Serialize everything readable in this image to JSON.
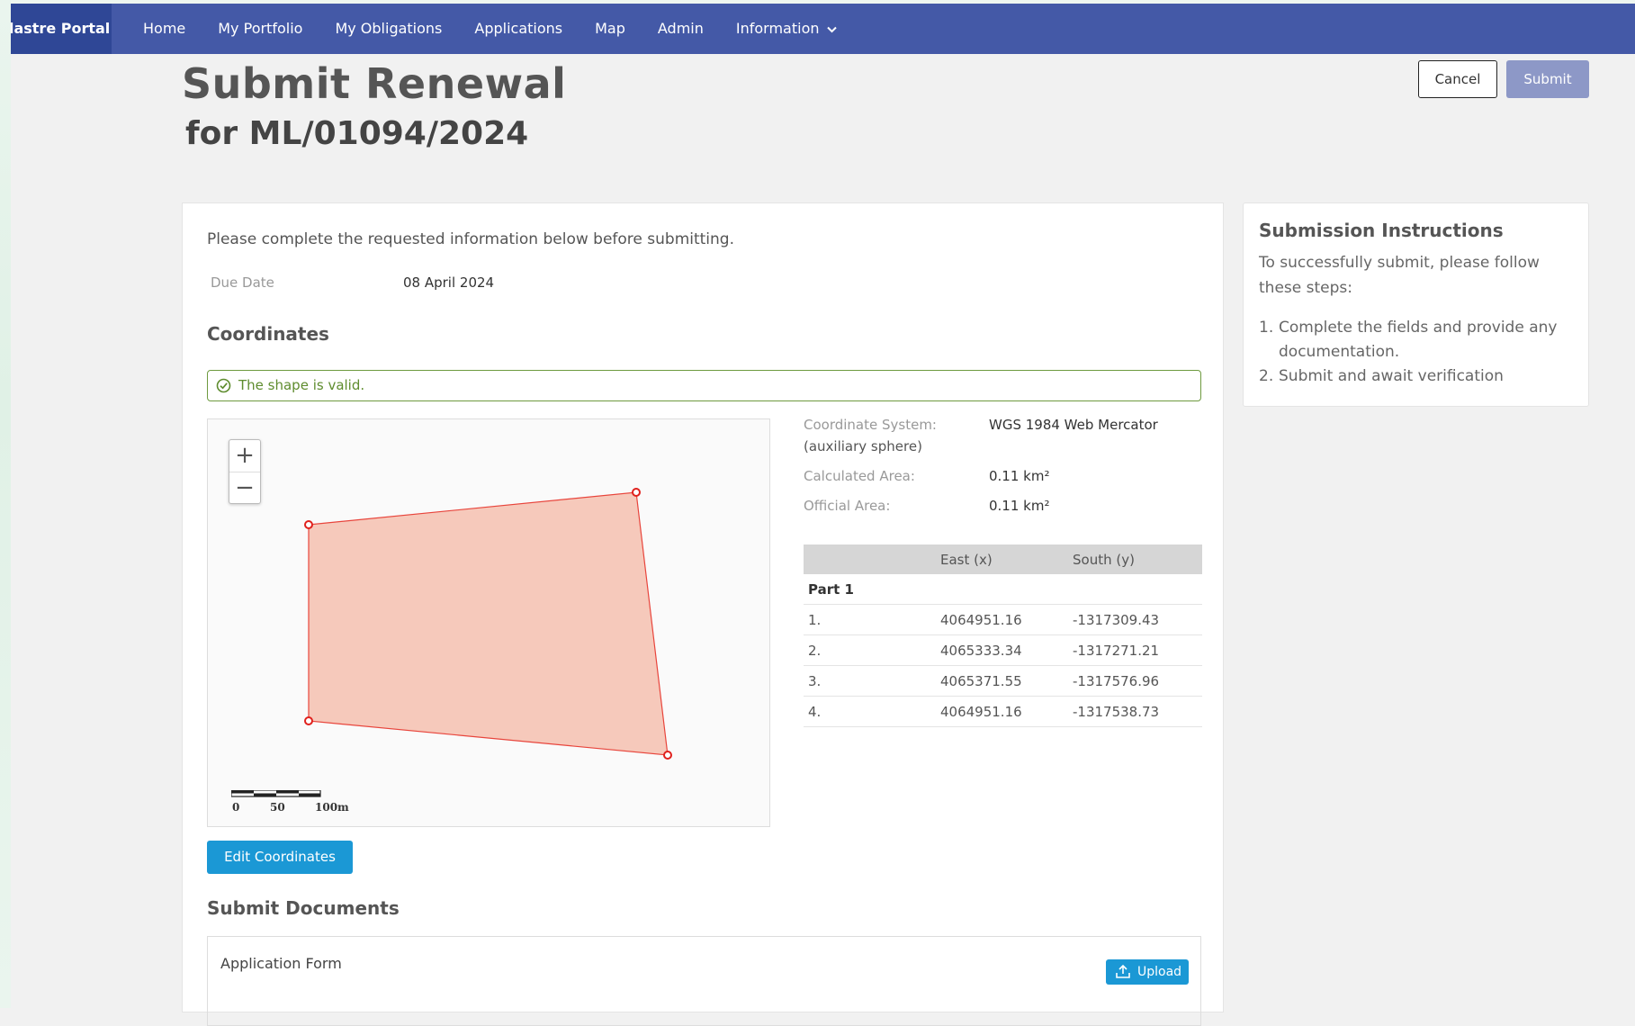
{
  "nav": {
    "brand": "dastre Portal",
    "items": [
      {
        "label": "Home"
      },
      {
        "label": "My Portfolio"
      },
      {
        "label": "My Obligations"
      },
      {
        "label": "Applications"
      },
      {
        "label": "Map"
      },
      {
        "label": "Admin"
      },
      {
        "label": "Information"
      }
    ]
  },
  "header": {
    "title": "Submit Renewal",
    "subtitle": "for ML/01094/2024",
    "cancel_label": "Cancel",
    "submit_label": "Submit"
  },
  "form": {
    "intro": "Please complete the requested information below before submitting.",
    "due_label": "Due Date",
    "due_value": "08 April 2024",
    "coordinates_heading": "Coordinates",
    "valid_message": "The shape is valid.",
    "edit_label": "Edit Coordinates",
    "documents_heading": "Submit Documents",
    "document_label": "Application Form",
    "upload_label": "Upload"
  },
  "map": {
    "zoom_in": "+",
    "zoom_out": "−",
    "scale_labels": [
      "0",
      "50",
      "100m"
    ]
  },
  "properties": {
    "coord_system_label": "Coordinate System:",
    "coord_system_label_cont": "(auxiliary sphere)",
    "coord_system_value": "WGS 1984 Web Mercator",
    "calc_area_label": "Calculated Area:",
    "calc_area_value": "0.11 km²",
    "official_area_label": "Official Area:",
    "official_area_value": "0.11 km²"
  },
  "coord_table": {
    "headers": [
      "",
      "East (x)",
      "South (y)"
    ],
    "part_label": "Part 1",
    "rows": [
      {
        "idx": "1.",
        "east": "4064951.16",
        "south": "-1317309.43"
      },
      {
        "idx": "2.",
        "east": "4065333.34",
        "south": "-1317271.21"
      },
      {
        "idx": "3.",
        "east": "4065371.55",
        "south": "-1317576.96"
      },
      {
        "idx": "4.",
        "east": "4064951.16",
        "south": "-1317538.73"
      }
    ]
  },
  "instructions": {
    "title": "Submission Instructions",
    "body": "To successfully submit, please follow these steps:",
    "steps": [
      {
        "num": "1.",
        "text": "Complete the fields and provide any documentation."
      },
      {
        "num": "2.",
        "text": "Submit and await verification"
      }
    ]
  },
  "colors": {
    "nav_bg": "#4459a7",
    "brand_bg": "#2f4796",
    "primary_button": "#1b98d5",
    "submit_disabled": "#8d98c7",
    "valid_green": "#6e9a3f",
    "polygon_fill": "#f6c9bb",
    "polygon_stroke": "#e8453c"
  }
}
